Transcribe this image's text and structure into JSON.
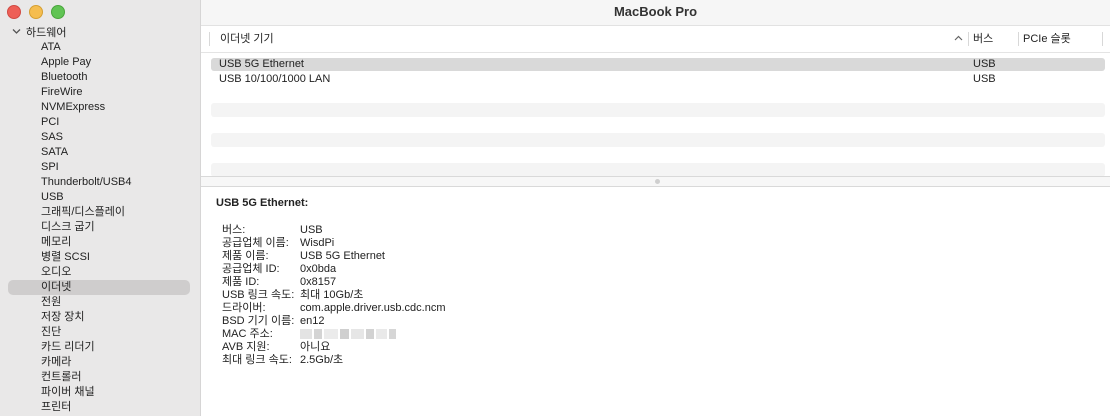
{
  "window": {
    "title": "MacBook Pro"
  },
  "sidebar": {
    "section_label": "하드웨어",
    "items": [
      {
        "label": "ATA"
      },
      {
        "label": "Apple Pay"
      },
      {
        "label": "Bluetooth"
      },
      {
        "label": "FireWire"
      },
      {
        "label": "NVMExpress"
      },
      {
        "label": "PCI"
      },
      {
        "label": "SAS"
      },
      {
        "label": "SATA"
      },
      {
        "label": "SPI"
      },
      {
        "label": "Thunderbolt/USB4"
      },
      {
        "label": "USB"
      },
      {
        "label": "그래픽/디스플레이"
      },
      {
        "label": "디스크 굽기"
      },
      {
        "label": "메모리"
      },
      {
        "label": "병렬 SCSI"
      },
      {
        "label": "오디오"
      },
      {
        "label": "이더넷",
        "selected": true
      },
      {
        "label": "전원"
      },
      {
        "label": "저장 장치"
      },
      {
        "label": "진단"
      },
      {
        "label": "카드 리더기"
      },
      {
        "label": "카메라"
      },
      {
        "label": "컨트롤러"
      },
      {
        "label": "파이버 채널"
      },
      {
        "label": "프린터"
      }
    ]
  },
  "table": {
    "columns": [
      "이더넷 기기",
      "버스",
      "PCIe 슬롯"
    ],
    "rows": [
      {
        "device": "USB 5G Ethernet",
        "bus": "USB",
        "slot": "",
        "selected": true
      },
      {
        "device": "USB 10/100/1000 LAN",
        "bus": "USB",
        "slot": ""
      }
    ]
  },
  "detail": {
    "title": "USB 5G Ethernet:",
    "fields": [
      {
        "key": "버스:",
        "value": "USB"
      },
      {
        "key": "공급업체 이름:",
        "value": "WisdPi"
      },
      {
        "key": "제품 이름:",
        "value": "USB 5G Ethernet"
      },
      {
        "key": "공급업체 ID:",
        "value": "0x0bda"
      },
      {
        "key": "제품 ID:",
        "value": "0x8157"
      },
      {
        "key": "USB 링크 속도:",
        "value": "최대 10Gb/초"
      },
      {
        "key": "드라이버:",
        "value": "com.apple.driver.usb.cdc.ncm"
      },
      {
        "key": "BSD 기기 이름:",
        "value": "en12"
      },
      {
        "key": "MAC 주소:",
        "value": "",
        "redacted": true
      },
      {
        "key": "AVB 지원:",
        "value": "아니요"
      },
      {
        "key": "최대 링크 속도:",
        "value": "2.5Gb/초"
      }
    ]
  },
  "colors": {
    "sidebar_bg": "#e9e8e8",
    "selection": "#cfcdcd",
    "close": "#ee5f57",
    "minimize": "#f5bd4f",
    "zoom": "#61c454"
  }
}
